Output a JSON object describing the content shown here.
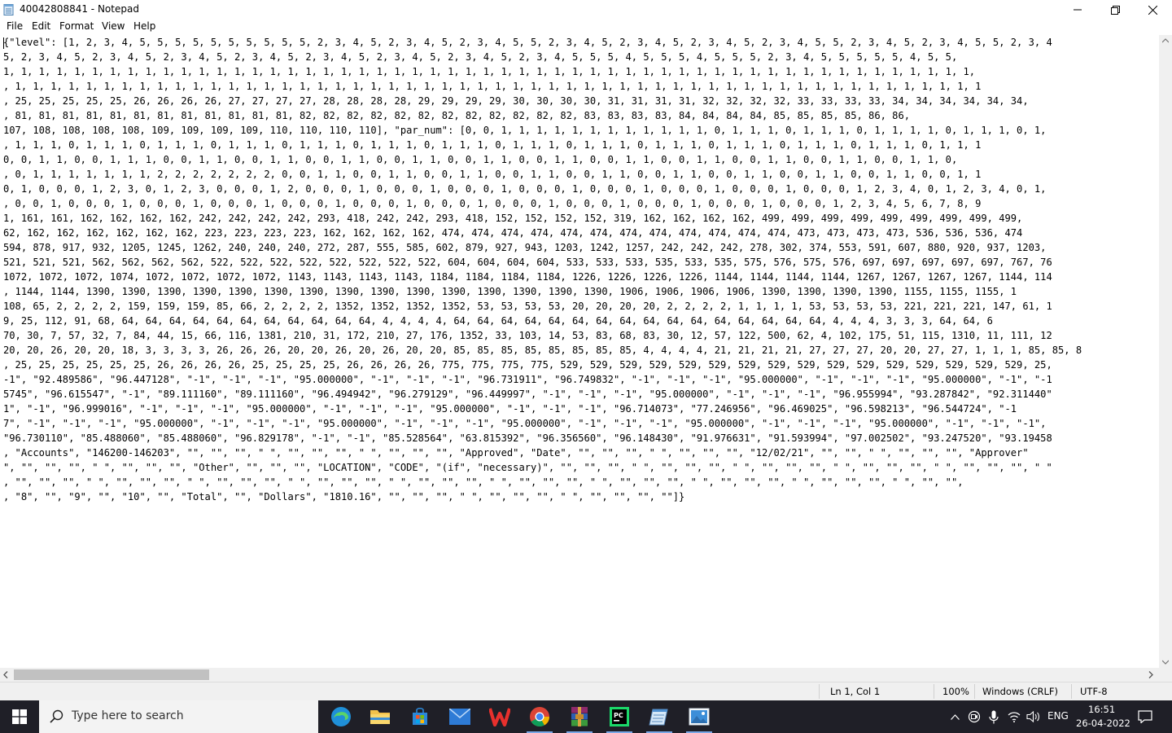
{
  "window": {
    "title": "40042808841 - Notepad"
  },
  "menu": [
    "File",
    "Edit",
    "Format",
    "View",
    "Help"
  ],
  "editor": {
    "lines": [
      "{\"level\": [1, 2, 3, 4, 5, 5, 5, 5, 5, 5, 5, 5, 5, 5, 2, 3, 4, 5, 2, 3, 4, 5, 2, 3, 4, 5, 5, 2, 3, 4, 5, 2, 3, 4, 5, 2, 3, 4, 5, 2, 3, 4, 5, 5, 2, 3, 4, 5, 2, 3, 4, 5, 5, 2, 3, 4",
      "5, 2, 3, 4, 5, 2, 3, 4, 5, 2, 3, 4, 5, 2, 3, 4, 5, 2, 3, 4, 5, 2, 3, 4, 5, 2, 3, 4, 5, 2, 3, 4, 5, 5, 5, 4, 5, 5, 5, 4, 5, 5, 5, 2, 3, 4, 5, 5, 5, 5, 5, 4, 5, 5,",
      "1, 1, 1, 1, 1, 1, 1, 1, 1, 1, 1, 1, 1, 1, 1, 1, 1, 1, 1, 1, 1, 1, 1, 1, 1, 1, 1, 1, 1, 1, 1, 1, 1, 1, 1, 1, 1, 1, 1, 1, 1, 1, 1, 1, 1, 1, 1, 1, 1, 1, 1, 1, 1, 1, 1,",
      ", 1, 1, 1, 1, 1, 1, 1, 1, 1, 1, 1, 1, 1, 1, 1, 1, 1, 1, 1, 1, 1, 1, 1, 1, 1, 1, 1, 1, 1, 1, 1, 1, 1, 1, 1, 1, 1, 1, 1, 1, 1, 1, 1, 1, 1, 1, 1, 1, 1, 1, 1, 1, 1, 1, 1",
      ", 25, 25, 25, 25, 25, 26, 26, 26, 26, 27, 27, 27, 27, 28, 28, 28, 28, 29, 29, 29, 29, 30, 30, 30, 30, 31, 31, 31, 31, 32, 32, 32, 32, 33, 33, 33, 33, 34, 34, 34, 34, 34, 34,",
      ", 81, 81, 81, 81, 81, 81, 81, 81, 81, 81, 81, 81, 82, 82, 82, 82, 82, 82, 82, 82, 82, 82, 82, 82, 83, 83, 83, 83, 84, 84, 84, 84, 85, 85, 85, 85, 86, 86,",
      "107, 108, 108, 108, 108, 109, 109, 109, 109, 110, 110, 110, 110], \"par_num\": [0, 0, 1, 1, 1, 1, 1, 1, 1, 1, 1, 1, 1, 1, 0, 1, 1, 1, 0, 1, 1, 1, 0, 1, 1, 1, 1, 0, 1, 1, 1, 0, 1,",
      ", 1, 1, 1, 0, 1, 1, 1, 0, 1, 1, 1, 0, 1, 1, 1, 0, 1, 1, 1, 0, 1, 1, 1, 0, 1, 1, 1, 0, 1, 1, 1, 0, 1, 1, 1, 0, 1, 1, 1, 0, 1, 1, 1, 0, 1, 1, 1, 0, 1, 1, 1, 0, 1, 1, 1",
      "0, 0, 1, 1, 0, 0, 1, 1, 1, 0, 0, 1, 1, 0, 0, 1, 1, 0, 0, 1, 1, 0, 0, 1, 1, 0, 0, 1, 1, 0, 0, 1, 1, 0, 0, 1, 1, 0, 0, 1, 1, 0, 0, 1, 1, 0, 0, 1, 1, 0, 0, 1, 1, 0,",
      ", 0, 1, 1, 1, 1, 1, 1, 1, 2, 2, 2, 2, 2, 2, 2, 0, 0, 1, 1, 0, 0, 1, 1, 0, 0, 1, 1, 0, 0, 1, 1, 0, 0, 1, 1, 0, 0, 1, 1, 0, 0, 1, 1, 0, 0, 1, 1, 0, 0, 1, 1, 0, 0, 1, 1",
      "0, 1, 0, 0, 0, 1, 2, 3, 0, 1, 2, 3, 0, 0, 0, 1, 2, 0, 0, 0, 1, 0, 0, 0, 1, 0, 0, 0, 1, 0, 0, 0, 1, 0, 0, 0, 1, 0, 0, 0, 1, 0, 0, 0, 1, 0, 0, 0, 1, 2, 3, 4, 0, 1, 2, 3, 4, 0, 1,",
      ", 0, 0, 1, 0, 0, 0, 1, 0, 0, 0, 1, 0, 0, 0, 1, 0, 0, 0, 1, 0, 0, 0, 1, 0, 0, 0, 1, 0, 0, 0, 1, 0, 0, 0, 1, 0, 0, 0, 1, 0, 0, 0, 1, 0, 0, 0, 1, 2, 3, 4, 5, 6, 7, 8, 9",
      "1, 161, 161, 162, 162, 162, 162, 242, 242, 242, 242, 293, 418, 242, 242, 293, 418, 152, 152, 152, 152, 319, 162, 162, 162, 162, 499, 499, 499, 499, 499, 499, 499, 499, 499,",
      "62, 162, 162, 162, 162, 162, 162, 223, 223, 223, 223, 162, 162, 162, 162, 474, 474, 474, 474, 474, 474, 474, 474, 474, 474, 474, 474, 473, 473, 473, 473, 536, 536, 536, 474",
      "594, 878, 917, 932, 1205, 1245, 1262, 240, 240, 240, 272, 287, 555, 585, 602, 879, 927, 943, 1203, 1242, 1257, 242, 242, 242, 278, 302, 374, 553, 591, 607, 880, 920, 937, 1203,",
      "521, 521, 521, 562, 562, 562, 562, 522, 522, 522, 522, 522, 522, 522, 522, 604, 604, 604, 604, 533, 533, 533, 535, 533, 535, 575, 576, 575, 576, 697, 697, 697, 697, 697, 767, 76",
      "1072, 1072, 1072, 1074, 1072, 1072, 1072, 1072, 1143, 1143, 1143, 1143, 1184, 1184, 1184, 1184, 1226, 1226, 1226, 1226, 1144, 1144, 1144, 1144, 1267, 1267, 1267, 1267, 1144, 114",
      ", 1144, 1144, 1390, 1390, 1390, 1390, 1390, 1390, 1390, 1390, 1390, 1390, 1390, 1390, 1390, 1390, 1390, 1906, 1906, 1906, 1906, 1390, 1390, 1390, 1390, 1155, 1155, 1155, 1",
      "108, 65, 2, 2, 2, 2, 159, 159, 159, 85, 66, 2, 2, 2, 2, 1352, 1352, 1352, 1352, 53, 53, 53, 53, 20, 20, 20, 20, 2, 2, 2, 2, 1, 1, 1, 1, 53, 53, 53, 53, 221, 221, 221, 147, 61, 1",
      "9, 25, 112, 91, 68, 64, 64, 64, 64, 64, 64, 64, 64, 64, 64, 64, 4, 4, 4, 4, 64, 64, 64, 64, 64, 64, 64, 64, 64, 64, 64, 64, 64, 64, 64, 64, 4, 4, 4, 3, 3, 3, 64, 64, 6",
      "70, 30, 7, 57, 32, 7, 84, 44, 15, 66, 116, 1381, 210, 31, 172, 210, 27, 176, 1352, 33, 103, 14, 53, 83, 68, 83, 30, 12, 57, 122, 500, 62, 4, 102, 175, 51, 115, 1310, 11, 111, 12",
      "20, 20, 26, 20, 20, 18, 3, 3, 3, 3, 26, 26, 26, 20, 20, 26, 20, 26, 20, 20, 85, 85, 85, 85, 85, 85, 85, 85, 4, 4, 4, 4, 21, 21, 21, 21, 27, 27, 27, 20, 20, 27, 27, 1, 1, 1, 85, 85, 8",
      ", 25, 25, 25, 25, 25, 25, 26, 26, 26, 26, 25, 25, 25, 25, 26, 26, 26, 26, 775, 775, 775, 775, 529, 529, 529, 529, 529, 529, 529, 529, 529, 529, 529, 529, 529, 529, 529, 529, 25,",
      "-1\", \"92.489586\", \"96.447128\", \"-1\", \"-1\", \"-1\", \"95.000000\", \"-1\", \"-1\", \"-1\", \"96.731911\", \"96.749832\", \"-1\", \"-1\", \"-1\", \"95.000000\", \"-1\", \"-1\", \"-1\", \"95.000000\", \"-1\", \"-1",
      "5745\", \"96.615547\", \"-1\", \"89.111160\", \"89.111160\", \"96.494942\", \"96.279129\", \"96.449997\", \"-1\", \"-1\", \"-1\", \"95.000000\", \"-1\", \"-1\", \"-1\", \"96.955994\", \"93.287842\", \"92.311440\"",
      "1\", \"-1\", \"96.999016\", \"-1\", \"-1\", \"-1\", \"95.000000\", \"-1\", \"-1\", \"-1\", \"95.000000\", \"-1\", \"-1\", \"-1\", \"96.714073\", \"77.246956\", \"96.469025\", \"96.598213\", \"96.544724\", \"-1",
      "7\", \"-1\", \"-1\", \"-1\", \"95.000000\", \"-1\", \"-1\", \"-1\", \"95.000000\", \"-1\", \"-1\", \"-1\", \"95.000000\", \"-1\", \"-1\", \"-1\", \"95.000000\", \"-1\", \"-1\", \"-1\", \"95.000000\", \"-1\", \"-1\", \"-1\",",
      "\"96.730110\", \"85.488060\", \"85.488060\", \"96.829178\", \"-1\", \"-1\", \"85.528564\", \"63.815392\", \"96.356560\", \"96.148430\", \"91.976631\", \"91.593994\", \"97.002502\", \"93.247520\", \"93.19458",
      ", \"Accounts\", \"146200-146203\", \"\", \"\", \"\", \" \", \"\", \"\", \"\", \" \", \"\", \"\", \"\", \"Approved\", \"Date\", \"\", \"\", \"\", \" \", \"\", \"\", \"\", \"12/02/21\", \"\", \"\", \" \", \"\", \"\", \"\", \"Approver\"",
      "\", \"\", \"\", \"\", \" \", \"\", \"\", \"\", \"Other\", \"\", \"\", \"\", \"LOCATION\", \"CODE\", \"(if\", \"necessary)\", \"\", \"\", \"\", \" \", \"\", \"\", \"\", \" \", \"\", \"\", \"\", \" \", \"\", \"\", \"\", \" \", \"\", \"\", \"\", \" \"",
      ", \"\", \"\", \"\", \" \", \"\", \"\", \"\", \" \", \"\", \"\", \"\", \" \", \"\", \"\", \"\", \" \", \"\", \"\", \"\", \" \", \"\", \"\", \"\", \" \", \"\", \"\", \"\", \" \", \"\", \"\", \"\", \" \", \"\", \"\", \"\", \" \", \"\", \"\",",
      ", \"8\", \"\", \"9\", \"\", \"10\", \"\", \"Total\", \"\", \"Dollars\", \"1810.16\", \"\", \"\", \"\", \" \", \"\", \"\", \"\", \" \", \"\", \"\", \"\", \"\"]}"
    ]
  },
  "status": {
    "position": "Ln 1, Col 1",
    "zoom": "100%",
    "line_ending": "Windows (CRLF)",
    "encoding": "UTF-8"
  },
  "taskbar": {
    "search_placeholder": "Type here to search",
    "apps": [
      "edge-icon",
      "file-explorer-icon",
      "store-icon",
      "mail-icon",
      "wps-office-icon",
      "chrome-icon",
      "winrar-icon",
      "pycharm-icon",
      "notepad-icon",
      "photos-icon"
    ],
    "language": "ENG",
    "time": "16:51",
    "date": "26-04-2022"
  }
}
